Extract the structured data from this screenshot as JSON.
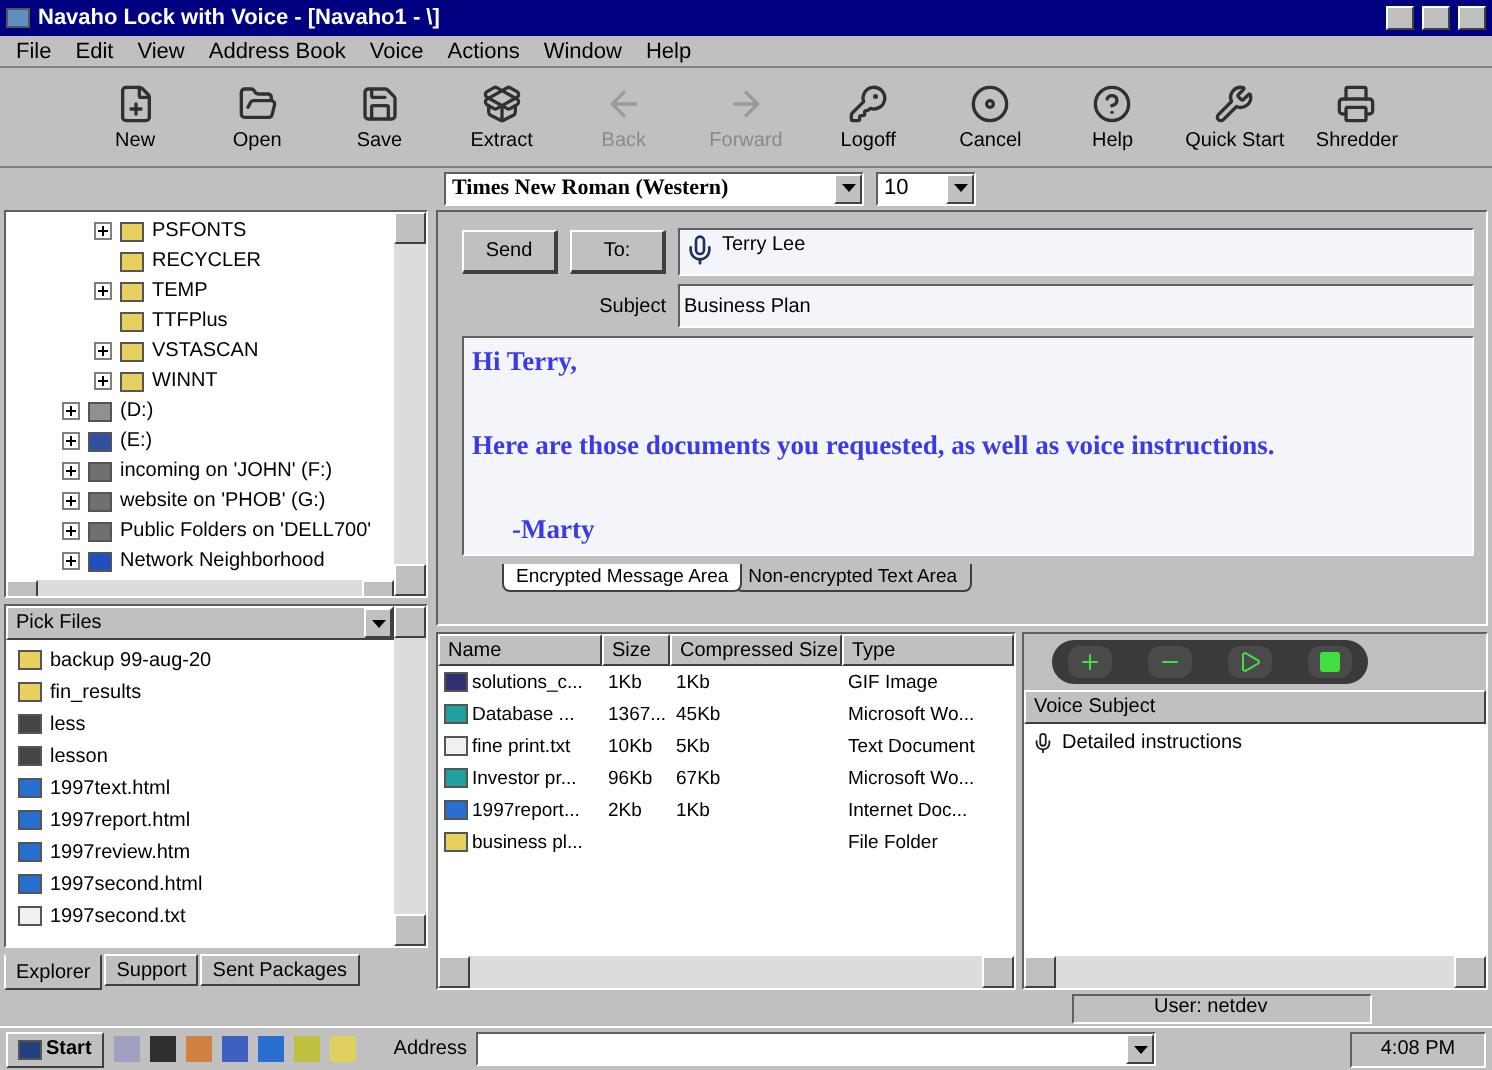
{
  "window": {
    "title": "Navaho Lock with Voice - [Navaho1 - \\]"
  },
  "menu": [
    "File",
    "Edit",
    "View",
    "Address Book",
    "Voice",
    "Actions",
    "Window",
    "Help"
  ],
  "toolbar": [
    {
      "label": "New",
      "kind": "new",
      "disabled": false
    },
    {
      "label": "Open",
      "kind": "open",
      "disabled": false
    },
    {
      "label": "Save",
      "kind": "save",
      "disabled": false
    },
    {
      "label": "Extract",
      "kind": "extract",
      "disabled": false
    },
    {
      "label": "Back",
      "kind": "back",
      "disabled": true
    },
    {
      "label": "Forward",
      "kind": "forward",
      "disabled": true
    },
    {
      "label": "Logoff",
      "kind": "logoff",
      "disabled": false
    },
    {
      "label": "Cancel",
      "kind": "cancel",
      "disabled": false
    },
    {
      "label": "Help",
      "kind": "help",
      "disabled": false
    },
    {
      "label": "Quick Start",
      "kind": "quickstart",
      "disabled": false
    },
    {
      "label": "Shredder",
      "kind": "shredder",
      "disabled": false
    }
  ],
  "format_bar": {
    "font": "Times New Roman (Western)",
    "size": "10"
  },
  "folder_tree": {
    "subfolders": [
      {
        "label": "PSFONTS",
        "expandable": true
      },
      {
        "label": "RECYCLER",
        "expandable": false
      },
      {
        "label": "TEMP",
        "expandable": true
      },
      {
        "label": "TTFPlus",
        "expandable": false
      },
      {
        "label": "VSTASCAN",
        "expandable": true
      },
      {
        "label": "WINNT",
        "expandable": true
      }
    ],
    "drives": [
      {
        "label": "(D:)",
        "kind": "drive"
      },
      {
        "label": "(E:)",
        "kind": "cdrom"
      },
      {
        "label": "incoming on 'JOHN' (F:)",
        "kind": "network"
      },
      {
        "label": "website on 'PHOB' (G:)",
        "kind": "network"
      },
      {
        "label": "Public Folders on 'DELL700'",
        "kind": "network"
      },
      {
        "label": "Network Neighborhood",
        "kind": "neighborhood"
      }
    ]
  },
  "pick_files": {
    "header": "Pick Files",
    "items": [
      {
        "label": "backup 99-aug-20",
        "kind": "folder"
      },
      {
        "label": "fin_results",
        "kind": "folder"
      },
      {
        "label": "less",
        "kind": "file"
      },
      {
        "label": "lesson",
        "kind": "file"
      },
      {
        "label": "1997text.html",
        "kind": "web"
      },
      {
        "label": "1997report.html",
        "kind": "web"
      },
      {
        "label": "1997review.htm",
        "kind": "web"
      },
      {
        "label": "1997second.html",
        "kind": "web"
      },
      {
        "label": "1997second.txt",
        "kind": "text"
      }
    ]
  },
  "left_tabs": [
    {
      "label": "Explorer",
      "selected": true
    },
    {
      "label": "Support",
      "selected": false
    },
    {
      "label": "Sent Packages",
      "selected": false
    }
  ],
  "compose": {
    "send": "Send",
    "to_button": "To:",
    "to": "Terry Lee",
    "subject_label": "Subject",
    "subject": "Business Plan",
    "body": [
      "Hi Terry,",
      "Here are those documents you requested, as well as voice instructions.",
      "-Marty"
    ],
    "tabs": [
      {
        "label": "Encrypted Message Area",
        "selected": true
      },
      {
        "label": "Non-encrypted Text Area",
        "selected": false
      }
    ]
  },
  "package_table": {
    "columns": [
      "Name",
      "Size",
      "Compressed Size",
      "Type"
    ],
    "rows": [
      {
        "kind": "image",
        "cells": [
          "solutions_c...",
          "1Kb",
          "1Kb",
          "GIF Image"
        ]
      },
      {
        "kind": "word",
        "cells": [
          "Database ...",
          "1367...",
          "45Kb",
          "Microsoft Wo..."
        ]
      },
      {
        "kind": "text",
        "cells": [
          "fine print.txt",
          "10Kb",
          "5Kb",
          "Text Document"
        ]
      },
      {
        "kind": "word",
        "cells": [
          "Investor pr...",
          "96Kb",
          "67Kb",
          "Microsoft Wo..."
        ]
      },
      {
        "kind": "web",
        "cells": [
          "1997report...",
          "2Kb",
          "1Kb",
          "Internet Doc..."
        ]
      },
      {
        "kind": "folder",
        "cells": [
          "business pl...",
          "",
          "",
          "File Folder"
        ]
      }
    ]
  },
  "voice": {
    "header": "Voice Subject",
    "items": [
      "Detailed instructions"
    ]
  },
  "status_bar": {
    "user": "User: netdev"
  },
  "taskbar": {
    "start": "Start",
    "address_label": "Address",
    "clock": "4:08 PM"
  }
}
